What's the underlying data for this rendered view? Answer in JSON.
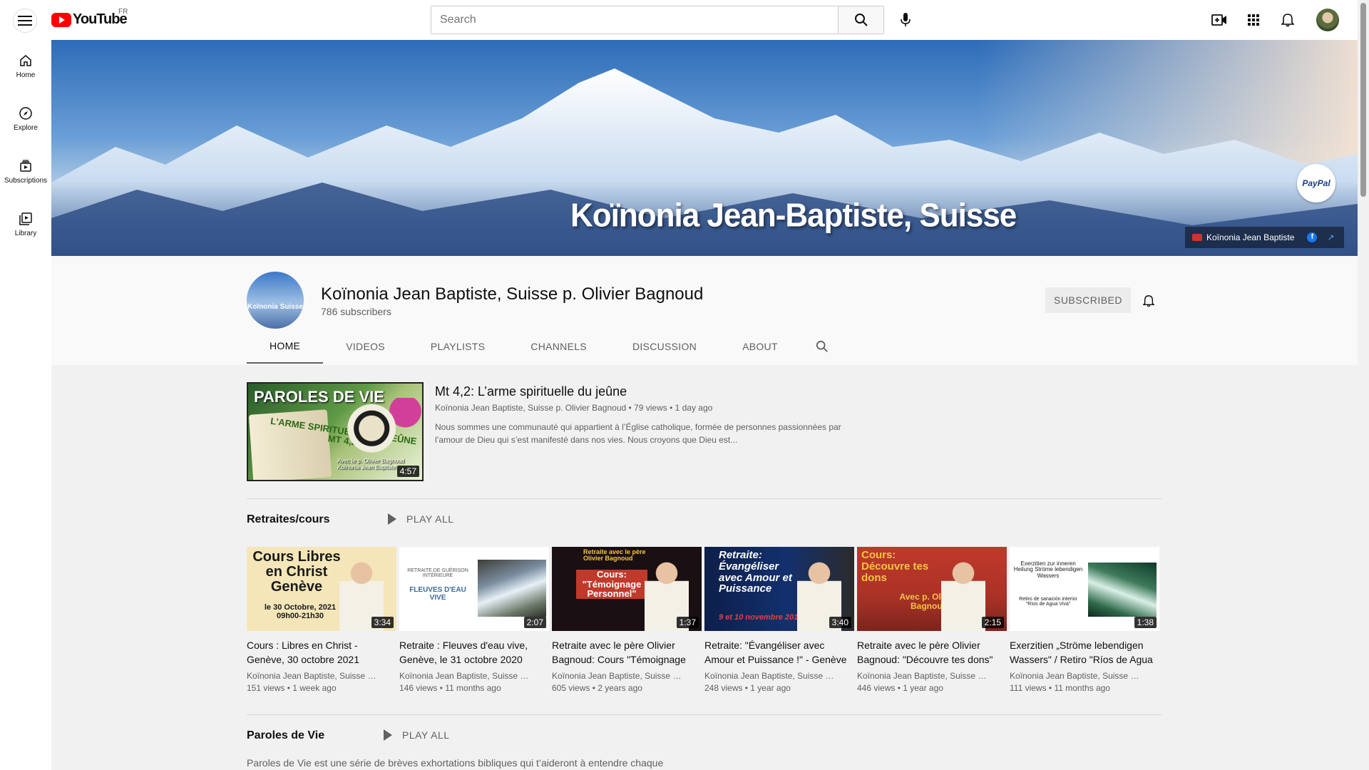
{
  "header": {
    "logo_text": "YouTube",
    "region": "FR",
    "search_placeholder": "Search"
  },
  "guide": [
    {
      "label": "Home",
      "icon": "home-icon"
    },
    {
      "label": "Explore",
      "icon": "compass-icon"
    },
    {
      "label": "Subscriptions",
      "icon": "subscriptions-icon"
    },
    {
      "label": "Library",
      "icon": "library-icon"
    }
  ],
  "banner": {
    "title": "Koïnonia Jean-Baptiste, Suisse",
    "paypal": "PayPal",
    "link_label": "Koïnonia Jean Baptiste"
  },
  "channel": {
    "avatar_text": "Koïnonia Suisse",
    "name": "Koïnonia Jean Baptiste, Suisse p. Olivier Bagnoud",
    "subscribers": "786 subscribers",
    "subscribe_label": "SUBSCRIBED"
  },
  "tabs": [
    "HOME",
    "VIDEOS",
    "PLAYLISTS",
    "CHANNELS",
    "DISCUSSION",
    "ABOUT"
  ],
  "featured": {
    "thumb_title": "PAROLES DE VIE",
    "thumb_book_text": "L'ARME SPIRITUELLE DU JEÛNE MT 4,2",
    "thumb_byline": "Avec le p. Olivier Bagnoud",
    "thumb_byline2": "Koïnonia Jean Baptiste",
    "duration": "4:57",
    "title": "Mt 4,2: L’arme spirituelle du jeûne",
    "channel": "Koïnonia Jean Baptiste, Suisse p. Olivier Bagnoud",
    "views": "79 views",
    "age": "1 day ago",
    "description": "Nous sommes une communauté qui appartient à l’Église catholique, formée de personnes passionnées par l’amour de Dieu qui s’est manifesté dans nos vies. Nous croyons que Dieu est..."
  },
  "shelf1": {
    "title": "Retraites/cours",
    "play_all": "PLAY ALL",
    "videos": [
      {
        "thumb_text": "Cours Libres en Christ Genève",
        "thumb_sub": "le 30 Octobre, 2021 09h00-21h30",
        "duration": "3:34",
        "title": "Cours : Libres en Christ - Genève, 30 octobre 2021",
        "channel": "Koïnonia Jean Baptiste, Suisse p. Olivier Bagnoud",
        "views": "151 views",
        "age": "1 week ago",
        "bg": "#f4e6b8",
        "fg": "#1a1a1a"
      },
      {
        "thumb_text": "FLEUVES D'EAU VIVE",
        "thumb_sub": "RETRAITE DE GUÉRISON INTÉRIEURE",
        "duration": "2:07",
        "title": "Retraite : Fleuves d'eau vive, Genève, le 31 octobre 2020",
        "channel": "Koïnonia Jean Baptiste, Suisse p. Olivier Bagnoud",
        "views": "146 views",
        "age": "11 months ago",
        "bg": "#ffffff",
        "fg": "#3a6a9a"
      },
      {
        "thumb_text": "Cours: \"Témoignage Personnel\"",
        "thumb_sub": "Retraite avec le père Olivier Bagnoud",
        "duration": "1:37",
        "title": "Retraite avec le père Olivier Bagnoud: Cours \"Témoignage Personnel\"",
        "channel": "Koïnonia Jean Baptiste, Suisse p. Olivier Bagnoud",
        "views": "605 views",
        "age": "2 years ago",
        "bg": "#1a0f12",
        "fg": "#ffffff"
      },
      {
        "thumb_text": "Retraite: Évangéliser avec Amour et Puissance",
        "thumb_sub": "9 et 10 novembre 2019",
        "duration": "3:40",
        "title": "Retraite: \"Évangéliser avec Amour et Puissance !\" - Genève",
        "channel": "Koïnonia Jean Baptiste, Suisse p. Olivier Bagnoud",
        "views": "248 views",
        "age": "1 year ago",
        "bg": "#0d1f4a",
        "fg": "#ffffff"
      },
      {
        "thumb_text": "Cours: Découvre tes dons",
        "thumb_sub": "Avec p. Olivier Bagnoud",
        "duration": "2:15",
        "title": "Retraite avec le père Olivier Bagnoud: \"Découvre tes dons\"",
        "channel": "Koïnonia Jean Baptiste, Suisse p. Olivier Bagnoud",
        "views": "446 views",
        "age": "1 year ago",
        "bg": "#c0392b",
        "fg": "#f5c542"
      },
      {
        "thumb_text": "Exerzitien zur inneren Heilung Ströme lebendigen Wassers",
        "thumb_sub": "Retiro de sanación interior \"Ríos de Agua Viva\"",
        "duration": "1:38",
        "title": "Exerzitien „Ströme lebendigen Wassers\" / Retiro \"Ríos de Agua Viva\"",
        "channel": "Koïnonia Jean Baptiste, Suisse p. Olivier Bagnoud",
        "views": "111 views",
        "age": "11 months ago",
        "bg": "#ffffff",
        "fg": "#1a1a1a"
      }
    ]
  },
  "shelf2": {
    "title": "Paroles de Vie",
    "play_all": "PLAY ALL",
    "description": "Paroles de Vie est une série de brèves exhortations bibliques qui t’aideront à entendre chaque"
  },
  "colors": {
    "accent": "#ff0000",
    "text_primary": "#0f0f0f",
    "text_secondary": "#606060"
  }
}
